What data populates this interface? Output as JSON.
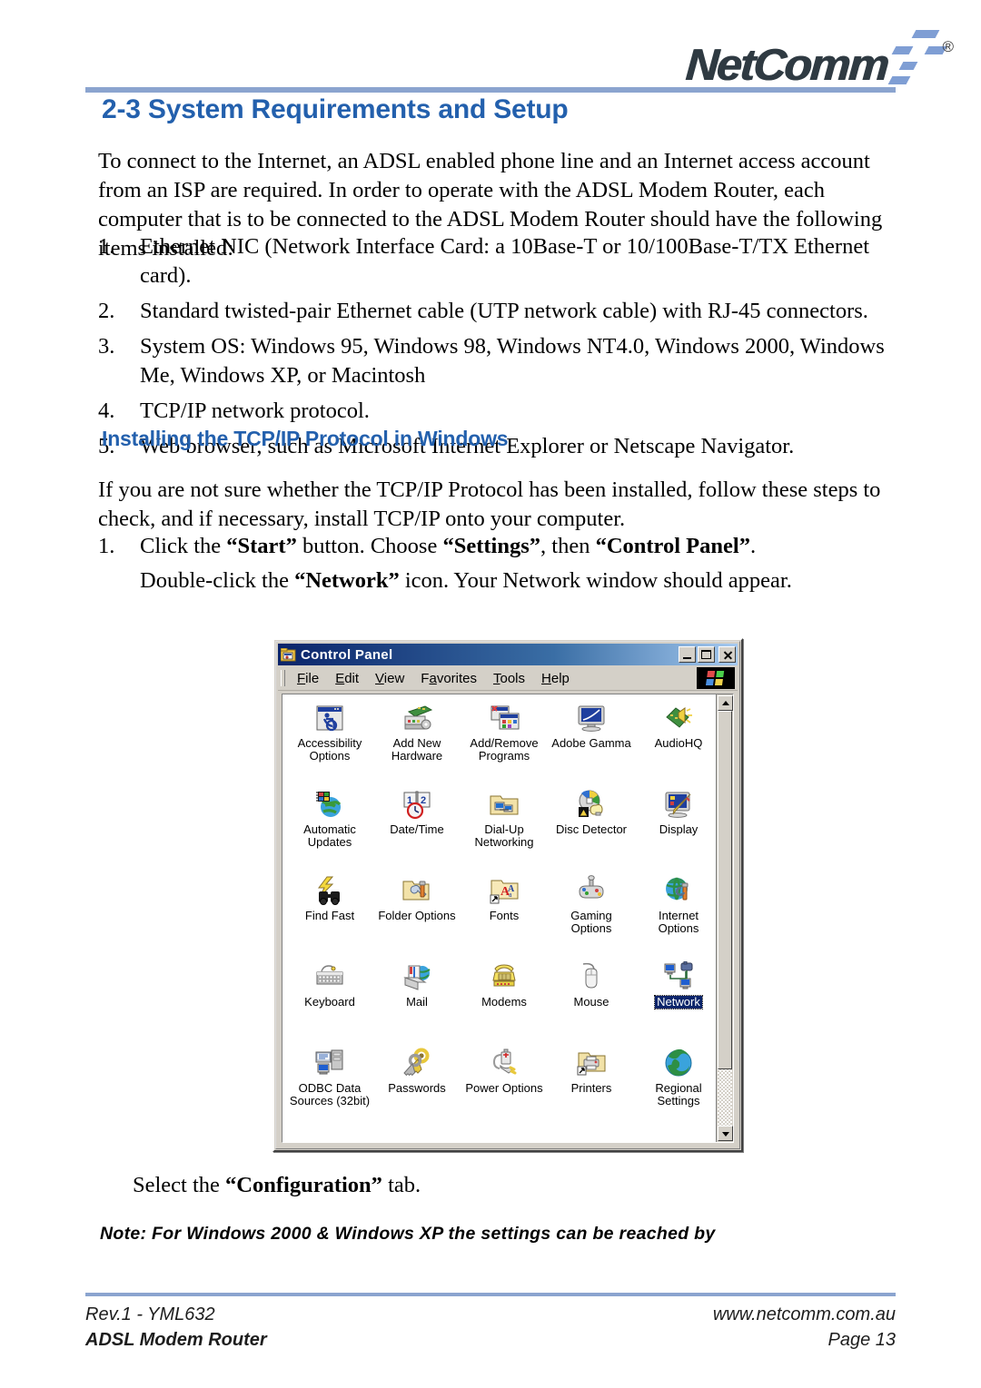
{
  "header": {
    "logo_text": "NetComm",
    "registered_mark": "®"
  },
  "section": {
    "heading": "2-3 System Requirements and Setup",
    "intro": "To connect to the Internet, an ADSL enabled phone line and an Internet access account from an ISP are required. In order to operate with the ADSL Modem Router, each computer that is to be connected to the ADSL Modem Router should have the following items installed:",
    "requirements": [
      {
        "num": "1.",
        "text": "Ethernet NIC (Network Interface Card: a 10Base-T or 10/100Base-T/TX Ethernet card)."
      },
      {
        "num": "2.",
        "text": "Standard twisted-pair Ethernet cable (UTP network cable) with RJ-45 connectors."
      },
      {
        "num": "3.",
        "text": "System OS: Windows 95, Windows 98, Windows NT4.0, Windows 2000, Windows Me, Windows XP, or Macintosh"
      },
      {
        "num": "4.",
        "text": "TCP/IP network protocol."
      },
      {
        "num": "5.",
        "text": "Web browser, such as Microsoft Internet Explorer or Netscape Navigator."
      }
    ]
  },
  "subsection": {
    "heading": "Installing the TCP/IP Protocol in Windows",
    "intro": "If you are not sure whether the TCP/IP Protocol has been installed, follow these steps to check, and if necessary, install TCP/IP onto your computer.",
    "step_num": "1.",
    "step_line1_a": "Click the ",
    "step_line1_b": "“Start”",
    "step_line1_c": " button. Choose ",
    "step_line1_d": "“Settings”",
    "step_line1_e": ", then ",
    "step_line1_f": "“Control Panel”",
    "step_line1_g": ".",
    "step_line2_a": "Double-click the ",
    "step_line2_b": "“Network”",
    "step_line2_c": " icon. Your Network window should appear.",
    "select_tab_a": "Select the ",
    "select_tab_b": "“Configuration”",
    "select_tab_c": " tab.",
    "note": "Note:  For Windows 2000 & Windows XP the settings can be reached by"
  },
  "control_panel": {
    "title": "Control Panel",
    "title_icon": "control-panel-folder-icon",
    "window_buttons": {
      "minimize": "minimize-button",
      "maximize": "maximize-button",
      "close": "close-button"
    },
    "menus": [
      {
        "pre": "",
        "accel": "F",
        "post": "ile"
      },
      {
        "pre": "",
        "accel": "E",
        "post": "dit"
      },
      {
        "pre": "",
        "accel": "V",
        "post": "iew"
      },
      {
        "pre": "F",
        "accel": "a",
        "post": "vorites"
      },
      {
        "pre": "",
        "accel": "T",
        "post": "ools"
      },
      {
        "pre": "",
        "accel": "H",
        "post": "elp"
      }
    ],
    "brand_logo": "windows-flag-logo",
    "items": [
      {
        "label": "Accessibility\nOptions",
        "icon": "accessibility-options-icon",
        "selected": false
      },
      {
        "label": "Add New\nHardware",
        "icon": "add-new-hardware-icon",
        "selected": false
      },
      {
        "label": "Add/Remove\nPrograms",
        "icon": "add-remove-programs-icon",
        "selected": false
      },
      {
        "label": "Adobe Gamma",
        "icon": "adobe-gamma-icon",
        "selected": false
      },
      {
        "label": "AudioHQ",
        "icon": "audiohq-icon",
        "selected": false
      },
      {
        "label": "Automatic\nUpdates",
        "icon": "automatic-updates-icon",
        "selected": false
      },
      {
        "label": "Date/Time",
        "icon": "date-time-icon",
        "selected": false
      },
      {
        "label": "Dial-Up\nNetworking",
        "icon": "dial-up-networking-icon",
        "selected": false
      },
      {
        "label": "Disc Detector",
        "icon": "disc-detector-icon",
        "selected": false
      },
      {
        "label": "Display",
        "icon": "display-icon",
        "selected": false
      },
      {
        "label": "Find Fast",
        "icon": "find-fast-icon",
        "selected": false
      },
      {
        "label": "Folder Options",
        "icon": "folder-options-icon",
        "selected": false
      },
      {
        "label": "Fonts",
        "icon": "fonts-icon",
        "selected": false
      },
      {
        "label": "Gaming\nOptions",
        "icon": "gaming-options-icon",
        "selected": false
      },
      {
        "label": "Internet\nOptions",
        "icon": "internet-options-icon",
        "selected": false
      },
      {
        "label": "Keyboard",
        "icon": "keyboard-icon",
        "selected": false
      },
      {
        "label": "Mail",
        "icon": "mail-icon",
        "selected": false
      },
      {
        "label": "Modems",
        "icon": "modems-icon",
        "selected": false
      },
      {
        "label": "Mouse",
        "icon": "mouse-icon",
        "selected": false
      },
      {
        "label": "Network",
        "icon": "network-icon",
        "selected": true
      },
      {
        "label": "ODBC Data\nSources (32bit)",
        "icon": "odbc-data-sources-icon",
        "selected": false
      },
      {
        "label": "Passwords",
        "icon": "passwords-icon",
        "selected": false
      },
      {
        "label": "Power Options",
        "icon": "power-options-icon",
        "selected": false
      },
      {
        "label": "Printers",
        "icon": "printers-icon",
        "selected": false
      },
      {
        "label": "Regional\nSettings",
        "icon": "regional-settings-icon",
        "selected": false
      }
    ]
  },
  "footer": {
    "rev": "Rev.1 - YML632",
    "product": "ADSL Modem Router",
    "website": "www.netcomm.com.au",
    "page": "Page 13"
  },
  "colors": {
    "heading_blue": "#2360ad",
    "rule_blue": "#8ba4cf",
    "title_bar_start": "#0a246a",
    "title_bar_end": "#a6caf0",
    "window_face": "#d4d0c8",
    "selection_blue": "#0a246a"
  }
}
